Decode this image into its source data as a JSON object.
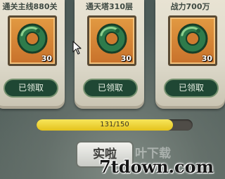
{
  "tasks": [
    {
      "title": "通关主线880关",
      "reward_icon": "jade-dragon-icon",
      "reward_qty": "30",
      "button": "已领取"
    },
    {
      "title": "通天塔310层",
      "reward_icon": "jade-dragon-icon",
      "reward_qty": "30",
      "button": "已领取"
    },
    {
      "title": "战力700万",
      "reward_icon": "jade-dragon-icon",
      "reward_qty": "30",
      "button": "已领取"
    }
  ],
  "progress": {
    "text": "131/150",
    "current": 131,
    "total": 150,
    "fraction": 0.873
  },
  "bottom_button": {
    "label": "实啦"
  },
  "watermark": {
    "logo": "叶下载",
    "url": "7tdown.com"
  },
  "colors": {
    "card_bg": "#e5e0d0",
    "slot_orange": "#d98537",
    "claimed_button": "#1f4734",
    "progress_yellow": "#f0d73a"
  }
}
